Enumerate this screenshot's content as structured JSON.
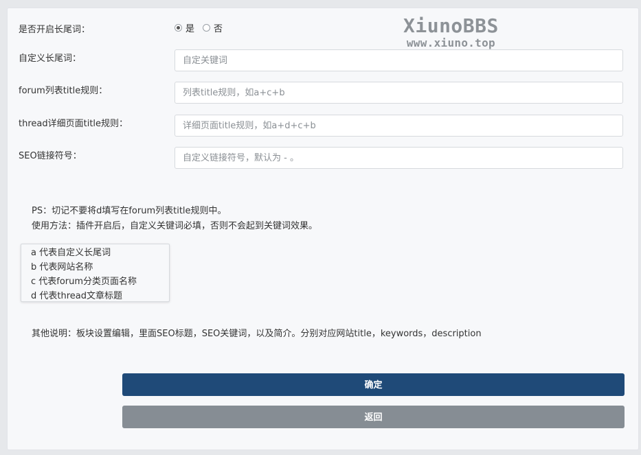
{
  "watermark": {
    "title": "XiunoBBS",
    "url": "www.xiuno.top"
  },
  "form": {
    "longtail_toggle": {
      "label": "是否开启长尾词：",
      "options": [
        "是",
        "否"
      ],
      "selected": "是"
    },
    "custom_longtail": {
      "label": "自定义长尾词：",
      "value": "",
      "placeholder": "自定关键词"
    },
    "forum_title_rule": {
      "label": "forum列表title规则：",
      "value": "",
      "placeholder": "列表title规则，如a+c+b"
    },
    "thread_title_rule": {
      "label": "thread详细页面title规则：",
      "value": "",
      "placeholder": "详细页面title规则，如a+d+c+b"
    },
    "seo_separator": {
      "label": "SEO链接符号：",
      "value": "",
      "placeholder": "自定义链接符号，默认为 - 。"
    }
  },
  "notes": {
    "ps": "PS：切记不要将d填写在forum列表title规则中。",
    "usage": "使用方法：插件开启后，自定义关键词必填，否则不会起到关键词效果。"
  },
  "legend": [
    "a 代表自定义长尾词",
    "b 代表网站名称",
    "c 代表forum分类页面名称",
    "d 代表thread文章标题"
  ],
  "other": "其他说明：板块设置编辑，里面SEO标题，SEO关键词，以及简介。分别对应网站title，keywords，description",
  "buttons": {
    "confirm": "确定",
    "back": "返回"
  },
  "colors": {
    "confirm_bg": "#1f4a78",
    "back_bg": "#868d94",
    "watermark": "#8d9297"
  }
}
